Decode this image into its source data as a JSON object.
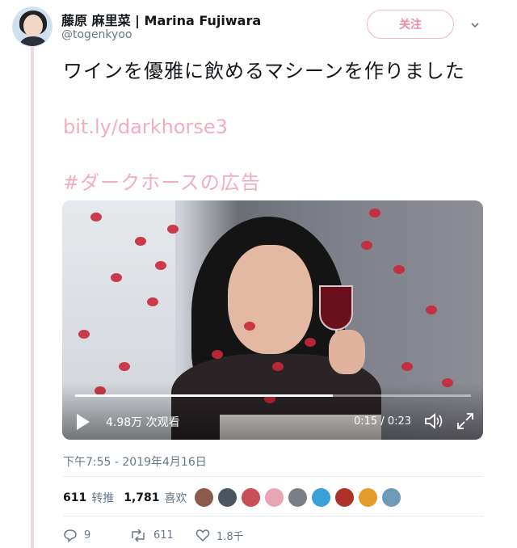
{
  "user": {
    "display_name": "藤原 麻里菜 | Marina Fujiwara",
    "handle": "@togenkyoo",
    "follow_label": "关注"
  },
  "tweet": {
    "text": "ワインを優雅に飲めるマシーンを作りました",
    "link": "bit.ly/darkhorse3",
    "hashtag": "#ダークホースの広告"
  },
  "video": {
    "views": "4.98万 次观看",
    "time": "0:15 / 0:23",
    "progress": 0.65
  },
  "timestamp": "下午7:55 - 2019年4月16日",
  "stats": {
    "retweets_count": "611",
    "retweets_label": "转推",
    "likes_count": "1,781",
    "likes_label": "喜欢"
  },
  "actions": {
    "replies": "9",
    "retweets": "611",
    "likes": "1.8千"
  },
  "colors": {
    "accent_pink": "#f2aebc",
    "follow_border": "#f2b8c7",
    "thread_line": "#f3d5dc",
    "muted": "#657786"
  },
  "liker_avatars": [
    "#8a5a4a",
    "#4b5560",
    "#c94f55",
    "#e7a5b5",
    "#7a7f86",
    "#3aa0d8",
    "#b0302a",
    "#e39b2c",
    "#6e9ab8"
  ]
}
